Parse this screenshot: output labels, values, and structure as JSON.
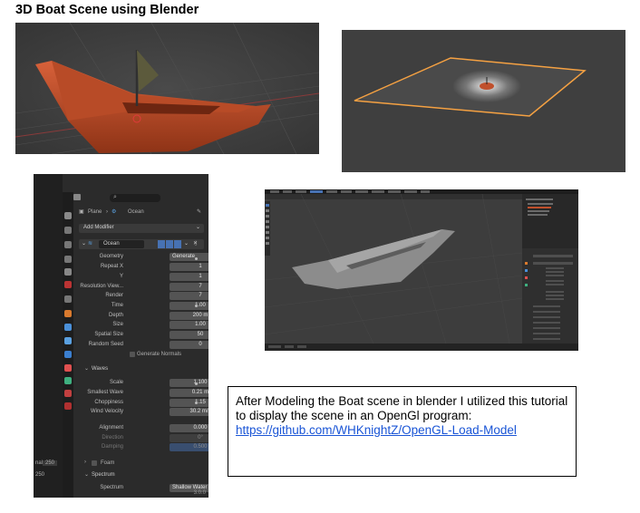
{
  "title": "3D Boat Scene using Blender",
  "properties_panel": {
    "search_placeholder": "",
    "breadcrumb_object": "Plane",
    "breadcrumb_modifier": "Ocean",
    "add_modifier": "Add Modifier",
    "modifier_name": "Ocean",
    "fields": [
      {
        "label": "Geometry",
        "value": "Generate"
      },
      {
        "label": "Repeat X",
        "value": "1"
      },
      {
        "label": "Y",
        "value": "1"
      },
      {
        "label": "Resolution View...",
        "value": "7"
      },
      {
        "label": "Render",
        "value": "7"
      },
      {
        "label": "Time",
        "value": "1.00"
      },
      {
        "label": "Depth",
        "value": "200 m"
      },
      {
        "label": "Size",
        "value": "1.00"
      },
      {
        "label": "Spatial Size",
        "value": "50"
      },
      {
        "label": "Random Seed",
        "value": "0"
      }
    ],
    "generate_normals": "Generate Normals",
    "waves_header": "Waves",
    "wave_fields": [
      {
        "label": "Scale",
        "value": "1.100"
      },
      {
        "label": "Smallest Wave",
        "value": "0.21 m"
      },
      {
        "label": "Choppiness",
        "value": "1.15"
      },
      {
        "label": "Wind Velocity",
        "value": "30.2 m/s"
      }
    ],
    "alignment_fields": [
      {
        "label": "Alignment",
        "value": "0.000"
      },
      {
        "label": "Direction",
        "value": "0°"
      },
      {
        "label": "Damping",
        "value": "0.500"
      }
    ],
    "foam_label": "Foam",
    "spectrum_header": "Spectrum",
    "spectrum_label": "Spectrum",
    "spectrum_value": "Shallow Water",
    "version": "3.0.0",
    "side_label_1": "nal",
    "side_value_1": "250",
    "side_label_2": "250"
  },
  "description": {
    "text": "After Modeling the Boat scene in blender I utilized this tutorial to display the scene in an OpenGl program:",
    "link": "https://github.com/WHKnightZ/OpenGL-Load-Model"
  },
  "colors": {
    "boat": "#c0502c",
    "selection": "#f5a142",
    "link": "#1a55d6",
    "active_field": "#4772b3"
  }
}
